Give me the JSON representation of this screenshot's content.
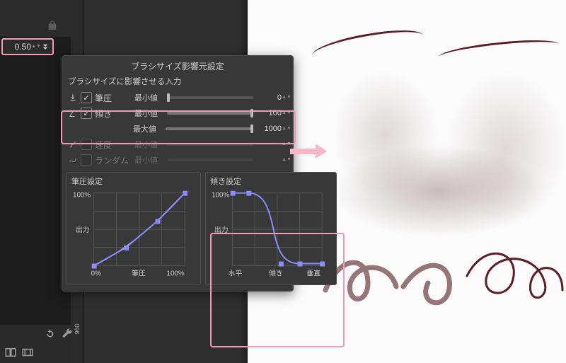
{
  "colors": {
    "accent_pink": "#f39ab4",
    "curve_line": "#8b8bff"
  },
  "value_input": "0.50",
  "ruler_ticks": [
    "960"
  ],
  "panel": {
    "title": "ブラシサイズ影響元設定",
    "subtitle": "ブラシサイズに影響させる入力",
    "sources": {
      "pressure": {
        "name": "筆圧",
        "checked": true,
        "min_label": "最小値",
        "min_value": "0"
      },
      "tilt": {
        "name": "傾き",
        "checked": true,
        "min_label": "最小値",
        "min_value": "100",
        "max_label": "最大値",
        "max_value": "1000"
      },
      "velocity": {
        "name": "速度",
        "checked": false,
        "min_label": "最小値"
      },
      "random": {
        "name": "ランダム",
        "checked": false,
        "min_label": "最小値"
      }
    },
    "pressure_curve": {
      "title": "筆圧設定",
      "ylabel": "出力",
      "y_top": "100%",
      "x_left": "0%",
      "x_mid": "筆圧",
      "x_right": "100%"
    },
    "tilt_curve": {
      "title": "傾き設定",
      "ylabel": "出力",
      "y_top": "100%",
      "x_left": "水平",
      "x_mid": "傾き",
      "x_right": "垂直"
    }
  },
  "chart_data": [
    {
      "type": "line",
      "title": "筆圧設定",
      "xlabel": "筆圧",
      "ylabel": "出力",
      "xlim": [
        0,
        100
      ],
      "ylim": [
        0,
        100
      ],
      "series": [
        {
          "name": "curve",
          "x": [
            0,
            50,
            100
          ],
          "y": [
            0,
            37,
            100
          ]
        },
        {
          "name": "control",
          "x": [
            0,
            35,
            70,
            100
          ],
          "y": [
            0,
            25,
            62,
            100
          ]
        }
      ]
    },
    {
      "type": "line",
      "title": "傾き設定",
      "xlabel": "傾き",
      "ylabel": "出力",
      "xlim": [
        0,
        100
      ],
      "ylim": [
        0,
        100
      ],
      "series": [
        {
          "name": "curve",
          "x": [
            0,
            18,
            32,
            45,
            58,
            75,
            100
          ],
          "y": [
            100,
            100,
            92,
            55,
            8,
            3,
            3
          ]
        }
      ]
    }
  ]
}
